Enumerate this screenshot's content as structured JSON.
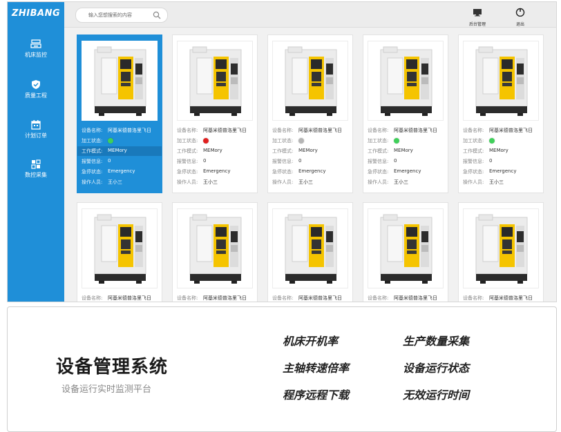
{
  "app": {
    "logo": "ZHIBANG"
  },
  "search": {
    "placeholder": "输入您想搜索的内容"
  },
  "top_actions": [
    {
      "label": "后台管理",
      "icon": "monitor-icon"
    },
    {
      "label": "退出",
      "icon": "power-icon"
    }
  ],
  "sidebar": {
    "items": [
      {
        "label": "机床监控",
        "icon": "machine-icon"
      },
      {
        "label": "质量工程",
        "icon": "shield-check-icon"
      },
      {
        "label": "计划订单",
        "icon": "calendar-icon"
      },
      {
        "label": "数控采集",
        "icon": "data-collect-icon"
      }
    ]
  },
  "colors": {
    "primary": "#1f8fd8",
    "status_green": "#3fcf5a",
    "status_red": "#e02020",
    "status_gray": "#b5b5b5"
  },
  "field_labels": {
    "name": "设备名称:",
    "status": "加工状态:",
    "mode": "工作模式:",
    "alarm": "报警信息:",
    "estop": "急停状态:",
    "operator": "操作人员:"
  },
  "cards": [
    {
      "name": "阿基米德普洛里飞日",
      "status": "green",
      "mode": "MEMory",
      "alarm": "0",
      "estop": "Emergency",
      "operator": "王小三",
      "selected": true
    },
    {
      "name": "阿基米德普洛里飞日",
      "status": "red",
      "mode": "MEMory",
      "alarm": "0",
      "estop": "Emergency",
      "operator": "王小三"
    },
    {
      "name": "阿基米德普洛里飞日",
      "status": "gray",
      "mode": "MEMory",
      "alarm": "0",
      "estop": "Emergency",
      "operator": "王小三"
    },
    {
      "name": "阿基米德普洛里飞日",
      "status": "green",
      "mode": "MEMory",
      "alarm": "0",
      "estop": "Emergency",
      "operator": "王小三"
    },
    {
      "name": "阿基米德普洛里飞日",
      "status": "green",
      "mode": "MEMory",
      "alarm": "0",
      "estop": "Emergency",
      "operator": "王小三"
    },
    {
      "name": "阿基米德普洛里飞日"
    },
    {
      "name": "阿基米德普洛里飞日"
    },
    {
      "name": "阿基米德普洛里飞日"
    },
    {
      "name": "阿基米德普洛里飞日"
    },
    {
      "name": "阿基米德普洛里飞日"
    }
  ],
  "panel": {
    "title": "设备管理系统",
    "subtitle": "设备运行实时监测平台",
    "features": [
      "机床开机率",
      "生产数量采集",
      "主轴转速倍率",
      "设备运行状态",
      "程序远程下载",
      "无效运行时间"
    ]
  }
}
